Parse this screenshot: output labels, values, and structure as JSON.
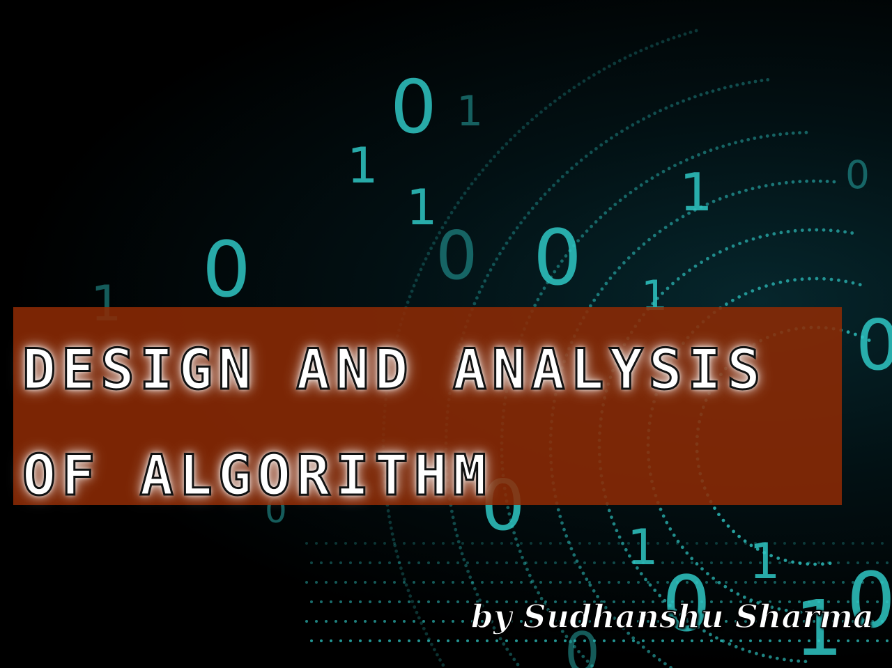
{
  "title": "DESIGN AND ANALYSIS OF ALGORITHM",
  "author": "by Sudhanshu Sharma",
  "colors": {
    "background": "#000000",
    "digits": "#2fc7c4",
    "title_band": "#8c2a04",
    "text": "#ffffff"
  }
}
